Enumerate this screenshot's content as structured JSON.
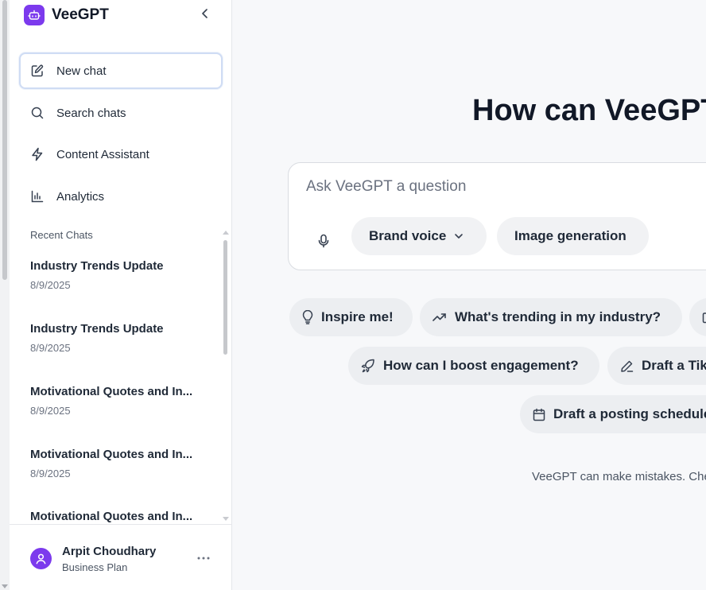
{
  "app": {
    "name": "VeeGPT"
  },
  "sidebar": {
    "nav": [
      {
        "label": "New chat",
        "icon": "edit-icon"
      },
      {
        "label": "Search chats",
        "icon": "search-icon"
      },
      {
        "label": "Content Assistant",
        "icon": "lightning-icon"
      },
      {
        "label": "Analytics",
        "icon": "bar-chart-icon"
      }
    ],
    "recent_title": "Recent Chats",
    "chats": [
      {
        "title": "Industry Trends Update",
        "date": "8/9/2025"
      },
      {
        "title": "Industry Trends Update",
        "date": "8/9/2025"
      },
      {
        "title": "Motivational Quotes and In...",
        "date": "8/9/2025"
      },
      {
        "title": "Motivational Quotes and In...",
        "date": "8/9/2025"
      },
      {
        "title": "Motivational Quotes and In...",
        "date": ""
      }
    ],
    "user": {
      "name": "Arpit Choudhary",
      "plan": "Business Plan"
    }
  },
  "main": {
    "headline": "How can VeeGPT help you today?",
    "composer": {
      "placeholder": "Ask VeeGPT a question",
      "brand_voice_label": "Brand voice",
      "image_generation_label": "Image generation"
    },
    "suggestions": [
      {
        "label": "Inspire me!",
        "icon": "lightbulb-icon"
      },
      {
        "label": "What's trending in my industry?",
        "icon": "trending-up-icon"
      },
      {
        "label": "How can I boost engagement?",
        "icon": "rocket-icon"
      },
      {
        "label": "Draft a TikTok script",
        "icon": "pencil-icon"
      },
      {
        "label": "Draft a posting schedule",
        "icon": "calendar-icon"
      }
    ],
    "disclaimer": "VeeGPT can make mistakes. Check important info."
  },
  "colors": {
    "accent": "#7c3aed",
    "active_border": "#cfdcf4",
    "chip_bg": "#eceef1"
  }
}
